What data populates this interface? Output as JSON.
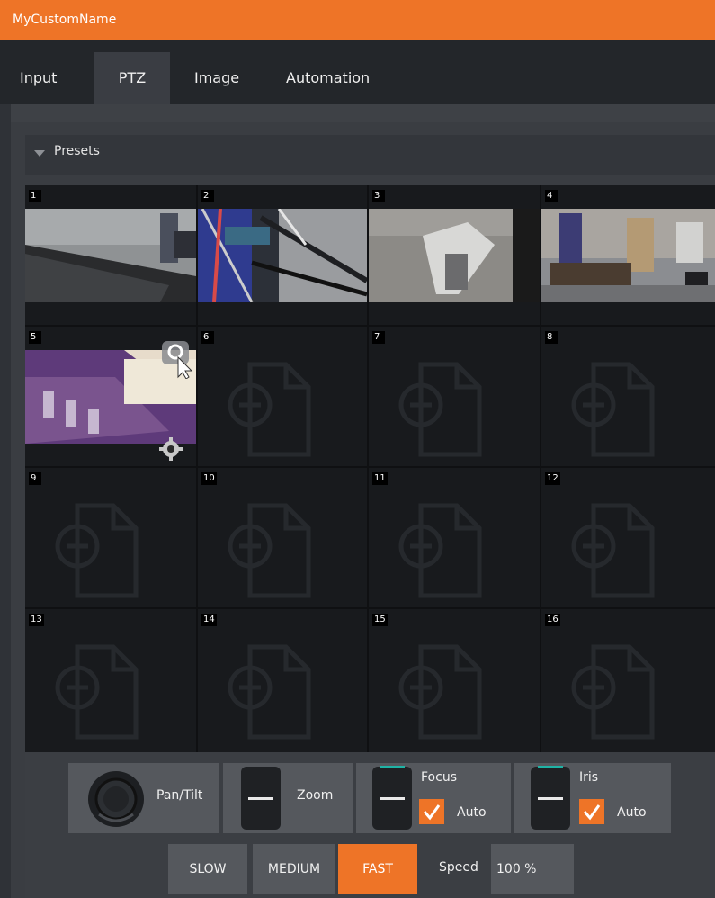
{
  "window": {
    "title": "MyCustomName"
  },
  "tabs": [
    {
      "label": "Input",
      "active": false
    },
    {
      "label": "PTZ",
      "active": true
    },
    {
      "label": "Image",
      "active": false
    },
    {
      "label": "Automation",
      "active": false
    }
  ],
  "presets": {
    "header": "Presets",
    "items": [
      {
        "num": "1",
        "stored": true
      },
      {
        "num": "2",
        "stored": true
      },
      {
        "num": "3",
        "stored": true
      },
      {
        "num": "4",
        "stored": true
      },
      {
        "num": "5",
        "stored": true
      },
      {
        "num": "6",
        "stored": false
      },
      {
        "num": "7",
        "stored": false
      },
      {
        "num": "8",
        "stored": false
      },
      {
        "num": "9",
        "stored": false
      },
      {
        "num": "10",
        "stored": false
      },
      {
        "num": "11",
        "stored": false
      },
      {
        "num": "12",
        "stored": false
      },
      {
        "num": "13",
        "stored": false
      },
      {
        "num": "14",
        "stored": false
      },
      {
        "num": "15",
        "stored": false
      },
      {
        "num": "16",
        "stored": false
      }
    ]
  },
  "controls": {
    "pan_tilt": "Pan/Tilt",
    "zoom": "Zoom",
    "focus": "Focus",
    "focus_auto": "Auto",
    "iris": "Iris",
    "iris_auto": "Auto"
  },
  "speed": {
    "slow": "SLOW",
    "medium": "MEDIUM",
    "fast": "FAST",
    "selected": "FAST",
    "label": "Speed",
    "value": "100 %"
  },
  "colors": {
    "accent": "#ee7427",
    "panel": "#3a3d42",
    "grid_bg": "#0f1012"
  }
}
